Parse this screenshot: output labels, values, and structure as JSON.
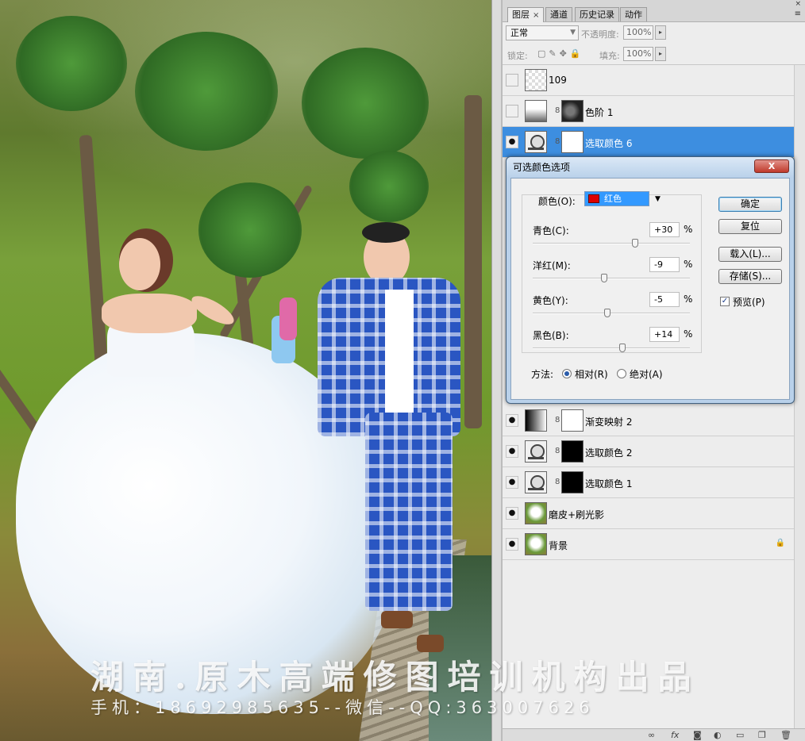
{
  "canvas": {
    "watermark_line1": "湖南.原木高端修图培训机构出品",
    "watermark_line2": "手机：18692985635--微信--QQ:363007626"
  },
  "panel": {
    "tabs": [
      {
        "label": "图层",
        "active": true
      },
      {
        "label": "通道",
        "active": false
      },
      {
        "label": "历史记录",
        "active": false
      },
      {
        "label": "动作",
        "active": false
      }
    ],
    "close_glyph": "×",
    "menu_glyph": "≡",
    "blend_mode": "正常",
    "opacity_label": "不透明度:",
    "opacity_value": "100%",
    "lock_label": "锁定:",
    "fill_label": "填充:",
    "fill_value": "100%",
    "layers": [
      {
        "name": "109",
        "visible": false,
        "thumb": "checker",
        "mask": null,
        "selected": false
      },
      {
        "name": "色阶 1",
        "visible": false,
        "thumb": "levels",
        "mask": "mask-g",
        "selected": false
      },
      {
        "name": "选取颜色 6",
        "visible": true,
        "thumb": "adj",
        "mask": "mask-w",
        "selected": true
      },
      {
        "name": "渐变映射 2",
        "visible": true,
        "thumb": "grad",
        "mask": "mask-w",
        "selected": false
      },
      {
        "name": "选取颜色 2",
        "visible": true,
        "thumb": "adj",
        "mask": "mask-b",
        "selected": false
      },
      {
        "name": "选取颜色 1",
        "visible": true,
        "thumb": "adj",
        "mask": "mask-b",
        "selected": false
      },
      {
        "name": "磨皮+刷光影",
        "visible": true,
        "thumb": "photo",
        "mask": null,
        "selected": false
      },
      {
        "name": "背景",
        "visible": true,
        "thumb": "photo",
        "mask": null,
        "selected": false,
        "locked": true
      }
    ],
    "bottom_icons": [
      "link-icon",
      "fx-icon",
      "mask-icon",
      "adjustment-icon",
      "group-icon",
      "new-layer-icon",
      "trash-icon"
    ]
  },
  "dialog": {
    "title": "可选颜色选项",
    "close_label": "X",
    "colors_label": "颜色(O):",
    "colors_value": "红色",
    "colors_swatch": "#dd0000",
    "sliders": [
      {
        "label": "青色(C):",
        "value": "+30",
        "pct": 0.65
      },
      {
        "label": "洋红(M):",
        "value": "-9",
        "pct": 0.455
      },
      {
        "label": "黄色(Y):",
        "value": "-5",
        "pct": 0.475
      },
      {
        "label": "黑色(B):",
        "value": "+14",
        "pct": 0.57
      }
    ],
    "percent": "%",
    "buttons": {
      "ok": "确定",
      "reset": "复位",
      "load": "载入(L)...",
      "save": "存储(S)..."
    },
    "preview_label": "预览(P)",
    "preview_checked": true,
    "method_label": "方法:",
    "method_relative": "相对(R)",
    "method_absolute": "绝对(A)",
    "method_selected": "relative"
  }
}
